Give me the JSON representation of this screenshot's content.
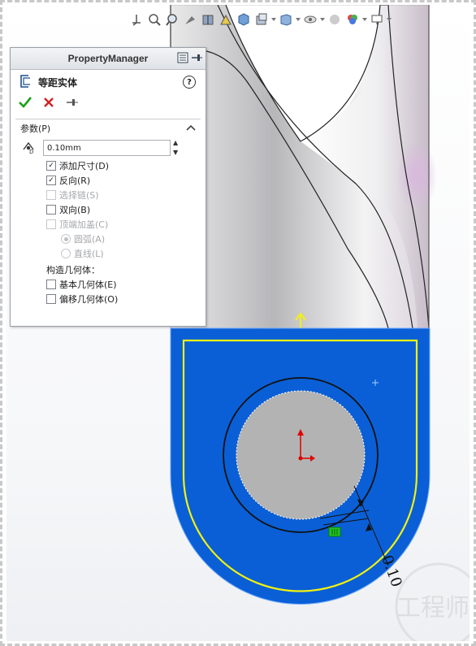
{
  "property_manager": {
    "title": "PropertyManager",
    "feature_name": "等距实体",
    "help_label": "?",
    "ok_icon": "check-icon",
    "cancel_icon": "cross-icon",
    "pin_icon": "pushpin-icon",
    "group_title": "参数(P)",
    "offset_value": "0.10mm",
    "options": [
      {
        "label": "添加尺寸(D)",
        "checked": true,
        "enabled": true
      },
      {
        "label": "反向(R)",
        "checked": true,
        "enabled": true
      },
      {
        "label": "选择链(S)",
        "checked": false,
        "enabled": false
      },
      {
        "label": "双向(B)",
        "checked": false,
        "enabled": true
      },
      {
        "label": "顶端加盖(C)",
        "checked": false,
        "enabled": false
      }
    ],
    "cap_options": [
      {
        "label": "圆弧(A)",
        "selected": true,
        "enabled": false
      },
      {
        "label": "直线(L)",
        "selected": false,
        "enabled": false
      }
    ],
    "construction_label": "构造几何体：",
    "construction_options": [
      {
        "label": "基本几何体(E)",
        "checked": false
      },
      {
        "label": "偏移几何体(O)",
        "checked": false
      }
    ]
  },
  "viewport": {
    "dimension_text": "0.10",
    "part_color": "#0a5fd6",
    "sketch_color": "#f2f20f",
    "hole_color": "#b3b3b3"
  },
  "toolbar": [
    "view-orientation-icon",
    "zoom-fit-icon",
    "zoom-area-icon",
    "previous-view-icon",
    "section-view-icon",
    "dynamic-annotation-icon",
    "view-settings-icon",
    "display-style-icon",
    "hide-show-icon",
    "edit-appearance-icon",
    "apply-scene-icon",
    "view-monitor-icon"
  ],
  "watermark_text": "工程师"
}
